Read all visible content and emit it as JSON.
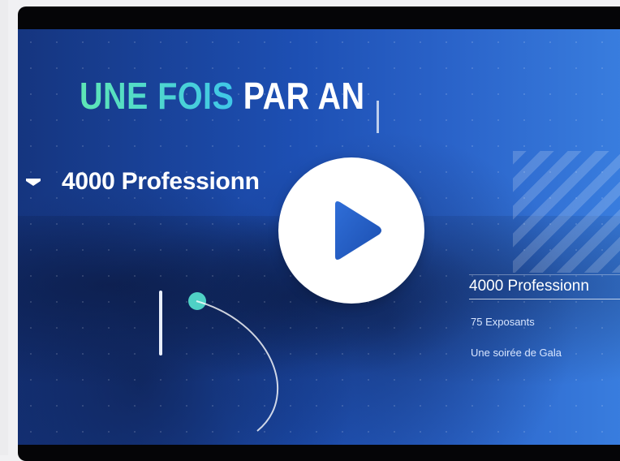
{
  "video": {
    "headline_accent": "UNE FOIS",
    "headline_rest": "PAR AN",
    "professionals_large": "4000 Professionn",
    "professionals_right": "4000 Professionn",
    "exhibitors": "75 Exposants",
    "gala": "Une soirée de Gala"
  },
  "player": {
    "play_icon": "play-icon"
  },
  "colors": {
    "accent_gradient_start": "#5ee6b5",
    "accent_gradient_end": "#3fc7e8",
    "overlay_blue": "#1d4fb3",
    "teal_dot": "#4fd1c5"
  }
}
